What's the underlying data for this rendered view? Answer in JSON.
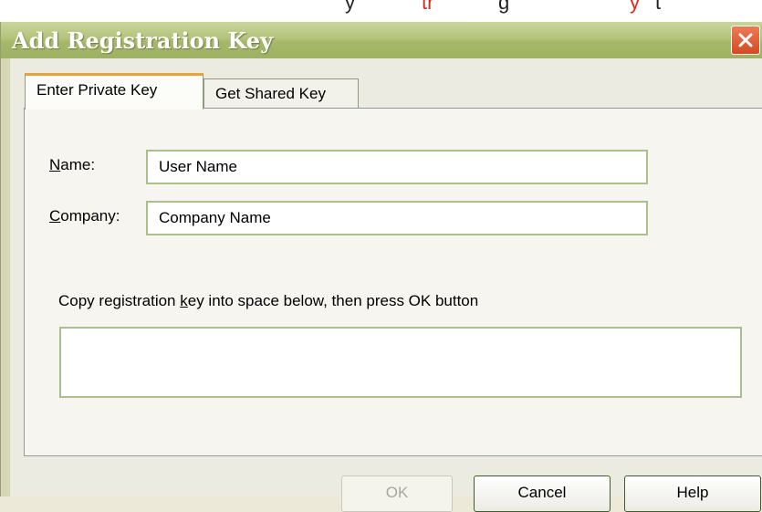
{
  "top_strip": {
    "fragments": [
      "y",
      "tr",
      "g",
      "y",
      "t"
    ]
  },
  "window": {
    "title": "Add Registration Key",
    "close_icon": "close-icon"
  },
  "tabs": [
    {
      "label": "Enter Private Key",
      "active": true
    },
    {
      "label": "Get Shared Key",
      "active": false
    }
  ],
  "form": {
    "name_label_accesskey": "N",
    "name_label_rest": "ame:",
    "name_value": "User Name",
    "company_label_accesskey": "C",
    "company_label_rest": "ompany:",
    "company_value": "Company Name",
    "hint_before": "Copy registration ",
    "hint_accesskey": "k",
    "hint_after": "ey into space below, then press OK button",
    "key_value": ""
  },
  "buttons": {
    "ok": "OK",
    "cancel": "Cancel",
    "help": "Help"
  },
  "colors": {
    "titlebar": "#a5b76a",
    "field_border": "#a9c08a",
    "close_button": "#d34a22",
    "tab_highlight": "#e9a23b"
  }
}
